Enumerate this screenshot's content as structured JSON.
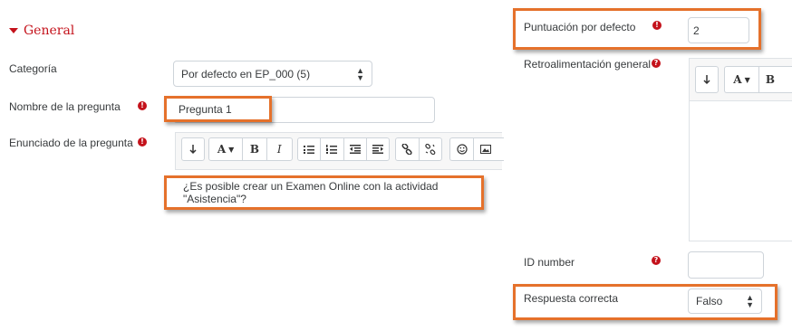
{
  "section": {
    "title": "General",
    "toggle_icon": "caret-down-icon"
  },
  "category": {
    "label": "Categoría",
    "value": "Por defecto en EP_000 (5)"
  },
  "question_name": {
    "label": "Nombre de la pregunta",
    "value": "Pregunta 1"
  },
  "question_text": {
    "label": "Enunciado de la pregunta",
    "value": "¿Es posible crear un Examen Online con la actividad \"Asistencia\"?"
  },
  "default_mark": {
    "label": "Puntuación por defecto",
    "value": "2"
  },
  "general_feedback": {
    "label": "Retroalimentación general"
  },
  "id_number": {
    "label": "ID number",
    "value": ""
  },
  "correct_answer": {
    "label": "Respuesta correcta",
    "value": "Falso"
  },
  "toolbar": {
    "font_button": "A",
    "bold": "B",
    "italic": "I"
  },
  "icons": {
    "required": "!",
    "help": "?"
  },
  "colors": {
    "accent": "#c4121b",
    "highlight": "#e5712b"
  }
}
